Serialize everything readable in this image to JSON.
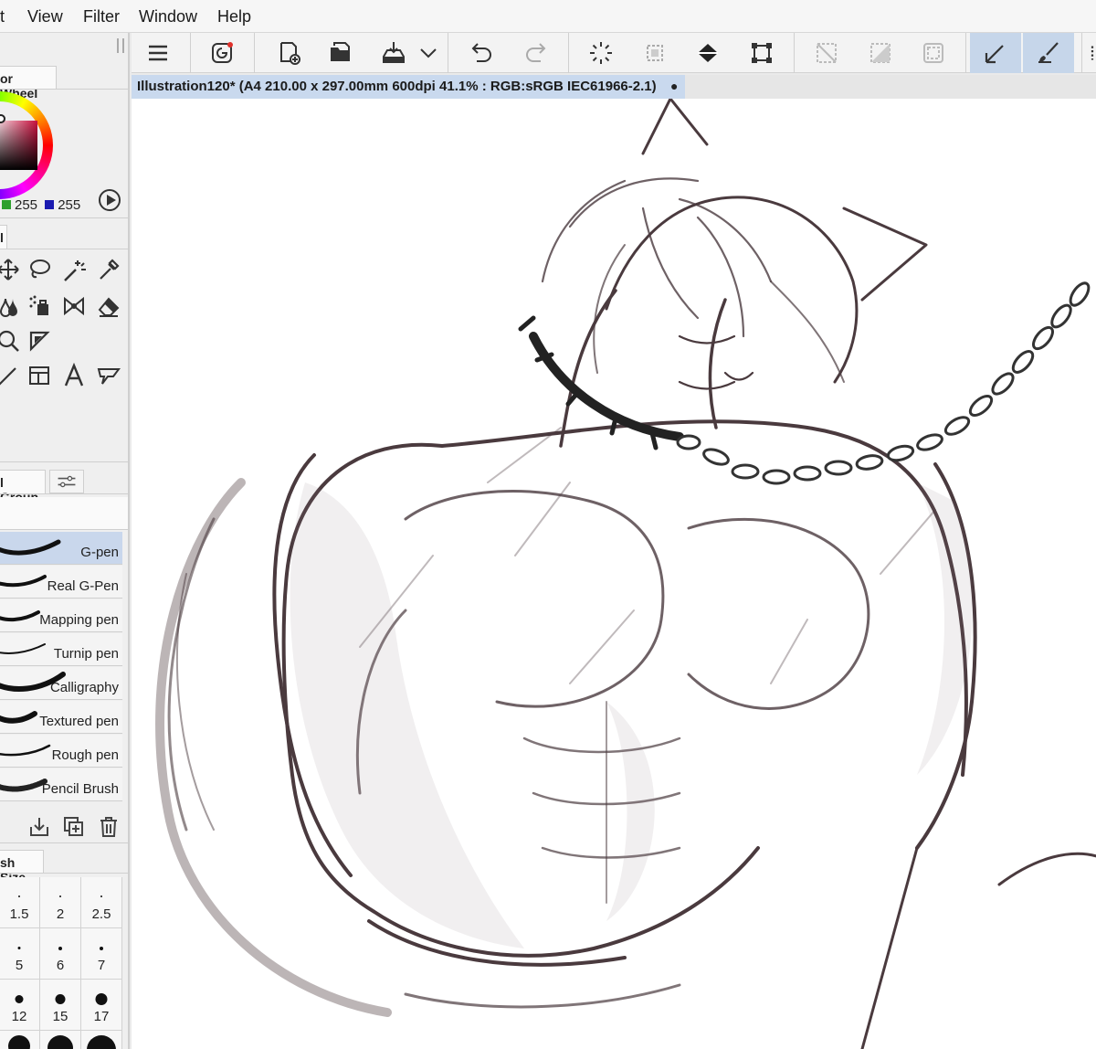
{
  "menubar": {
    "items": [
      "t",
      "View",
      "Filter",
      "Window",
      "Help"
    ]
  },
  "color_panel": {
    "tab_label": "or Wheel",
    "green_value": "255",
    "blue_value": "255",
    "main_color": "#c8103e"
  },
  "tool_panel": {
    "tab_label": "l",
    "tools": [
      "move-icon",
      "lasso-icon",
      "auto-select-icon",
      "eyedropper-icon",
      "fill-icon",
      "airbrush-icon",
      "decoration-icon",
      "eraser-icon",
      "zoom-icon",
      "ruler-icon",
      "line-icon",
      "frame-icon",
      "text-icon",
      "balloon-icon"
    ]
  },
  "sub_tool_panel": {
    "tab_label": "l Group",
    "brushes": [
      {
        "label": "G-pen",
        "selected": true
      },
      {
        "label": "Real G-Pen",
        "selected": false
      },
      {
        "label": "Mapping pen",
        "selected": false
      },
      {
        "label": "Turnip pen",
        "selected": false
      },
      {
        "label": "Calligraphy",
        "selected": false
      },
      {
        "label": "Textured pen",
        "selected": false
      },
      {
        "label": "Rough pen",
        "selected": false
      },
      {
        "label": "Pencil Brush",
        "selected": false
      }
    ]
  },
  "brush_size_panel": {
    "tab_label": "sh Size",
    "sizes": [
      "1.5",
      "2",
      "2.5",
      "5",
      "6",
      "7",
      "12",
      "15",
      "17"
    ]
  },
  "toolbar": {
    "buttons": [
      "menu-icon",
      "companion-icon",
      "new-icon",
      "open-icon",
      "save-icon",
      "chevron-down-icon",
      "undo-icon",
      "redo-icon",
      "loading-icon",
      "clear-selection-icon",
      "fill-bucket-icon",
      "transform-icon",
      "deselect-icon",
      "invert-selection-icon",
      "show-selection-icon",
      "pen-pressure-icon",
      "brush-icon"
    ],
    "active": [
      "pen-pressure-icon",
      "brush-icon"
    ]
  },
  "document": {
    "tab_title": "Illustration120* (A4 210.00 x 297.00mm 600dpi 41.1% : RGB:sRGB IEC61966-2.1)",
    "modified_marker": "●"
  },
  "colors": {
    "accent": "#c6d6ea",
    "selected_row": "#c9d7ec",
    "panel_bg": "#efefef",
    "sketch_line": "#4a3a3e"
  }
}
